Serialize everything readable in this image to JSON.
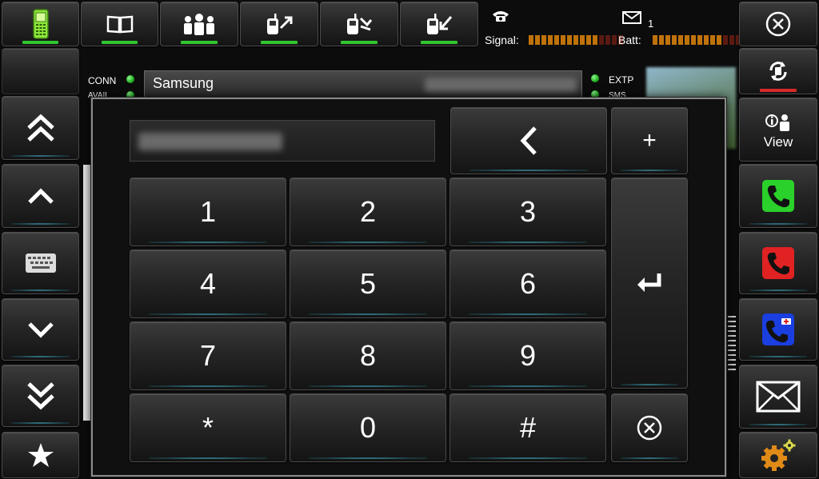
{
  "toolbar": {
    "tabs": [
      {
        "name": "phone",
        "icon": "mobile-phone-icon"
      },
      {
        "name": "phonebook",
        "icon": "book-icon"
      },
      {
        "name": "contacts",
        "icon": "people-icon"
      },
      {
        "name": "dialed",
        "icon": "outgoing-call-icon"
      },
      {
        "name": "missed",
        "icon": "missed-call-icon"
      },
      {
        "name": "received",
        "icon": "incoming-call-icon"
      }
    ]
  },
  "status": {
    "message_count": "1",
    "signal_label": "Signal:",
    "batt_label": "Batt:",
    "signal_level": 0.7,
    "battery_level": 0.7
  },
  "info": {
    "conn_label": "CONN",
    "avail_label": "AVAIL",
    "extp_label": "EXTP",
    "sms_label": "SMS",
    "contact_name": "Samsung"
  },
  "left_sidebar": [
    "page-up",
    "up",
    "keyboard",
    "down",
    "page-down",
    "favorites"
  ],
  "right_sidebar": {
    "view_label": "View"
  },
  "keypad": {
    "keys": [
      "1",
      "2",
      "3",
      "4",
      "5",
      "6",
      "7",
      "8",
      "9",
      "*",
      "0",
      "#"
    ],
    "plus_label": "+"
  },
  "colors": {
    "accent_glow": "#50c8dc",
    "active_bar": "#2fc52f",
    "call_green": "#2ad12a",
    "call_red": "#e02222",
    "call_blue": "#1a3ee0",
    "meter_on": "#c0720a",
    "meter_off": "#5a1a12"
  }
}
